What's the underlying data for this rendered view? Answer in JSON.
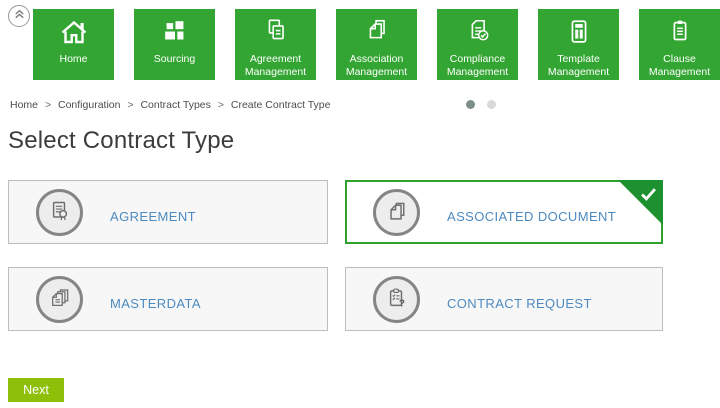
{
  "colors": {
    "tile_green": "#33a532",
    "selected_green": "#2da22d",
    "triangle_green": "#1d9130",
    "next_green": "#8ec009",
    "link_blue": "#4d8ac0",
    "dot_active": "#7d8e87",
    "dot_inactive": "#d9d9d9"
  },
  "header": {
    "collapse_icon": "double-chevron-up",
    "tiles": [
      {
        "label": "Home",
        "icon": "home-icon"
      },
      {
        "label": "Sourcing",
        "icon": "sourcing-grid-icon"
      },
      {
        "label": "Agreement Management",
        "icon": "agreement-documents-icon"
      },
      {
        "label": "Association Management",
        "icon": "association-documents-icon"
      },
      {
        "label": "Compliance Management",
        "icon": "compliance-document-check-icon"
      },
      {
        "label": "Template Management",
        "icon": "template-layout-icon"
      },
      {
        "label": "Clause Management",
        "icon": "clause-clipboard-icon"
      }
    ]
  },
  "breadcrumb": {
    "separator": ">",
    "items": [
      "Home",
      "Configuration",
      "Contract Types",
      "Create Contract Type"
    ]
  },
  "carousel": {
    "dot_count": 2,
    "active_index": 0
  },
  "main": {
    "title": "Select Contract Type",
    "cards": [
      {
        "label": "AGREEMENT",
        "icon": "certificate-document-icon",
        "selected": false
      },
      {
        "label": "ASSOCIATED DOCUMENT",
        "icon": "stacked-documents-icon",
        "selected": true
      },
      {
        "label": "MASTERDATA",
        "icon": "document-stack-icon",
        "selected": false
      },
      {
        "label": "CONTRACT REQUEST",
        "icon": "clipboard-question-icon",
        "selected": false
      }
    ]
  },
  "footer": {
    "next_label": "Next"
  }
}
